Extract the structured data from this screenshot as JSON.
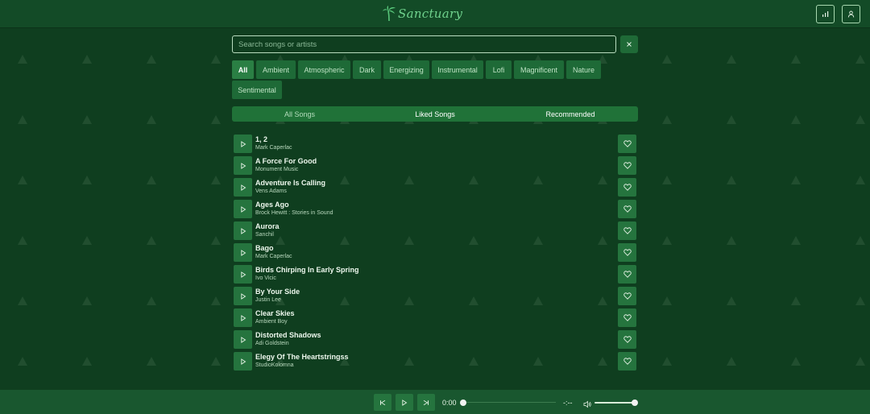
{
  "app": {
    "title": "Sanctuary"
  },
  "header": {
    "stats_icon": "bar-chart-icon",
    "user_icon": "user-icon"
  },
  "search": {
    "placeholder": "Search songs or artists",
    "value": ""
  },
  "genres": [
    {
      "label": "All",
      "active": true
    },
    {
      "label": "Ambient",
      "active": false
    },
    {
      "label": "Atmospheric",
      "active": false
    },
    {
      "label": "Dark",
      "active": false
    },
    {
      "label": "Energizing",
      "active": false
    },
    {
      "label": "Instrumental",
      "active": false
    },
    {
      "label": "Lofi",
      "active": false
    },
    {
      "label": "Magnificent",
      "active": false
    },
    {
      "label": "Nature",
      "active": false
    },
    {
      "label": "Sentimental",
      "active": false
    }
  ],
  "tabs": [
    {
      "label": "All Songs",
      "active": true
    },
    {
      "label": "Liked Songs",
      "active": false
    },
    {
      "label": "Recommended",
      "active": false
    }
  ],
  "songs": [
    {
      "title": "1, 2",
      "artist": "Mark Caperlac"
    },
    {
      "title": "A Force For Good",
      "artist": "Monument Music"
    },
    {
      "title": "Adventure Is Calling",
      "artist": "Vens Adams"
    },
    {
      "title": "Ages Ago",
      "artist": "Brock Hewitt : Stories in Sound"
    },
    {
      "title": "Aurora",
      "artist": "Sanchil"
    },
    {
      "title": "Bago",
      "artist": "Mark Caperlac"
    },
    {
      "title": "Birds Chirping In Early Spring",
      "artist": "Ivo Vicic"
    },
    {
      "title": "By Your Side",
      "artist": "Justin Lee"
    },
    {
      "title": "Clear Skies",
      "artist": "Ambient Boy"
    },
    {
      "title": "Distorted Shadows",
      "artist": "Adi Goldstein"
    },
    {
      "title": "Elegy Of The Heartstringss",
      "artist": "StudioKolomna"
    }
  ],
  "player": {
    "current_time": "0:00",
    "duration": "-:--",
    "progress": 0,
    "volume": 1.0
  },
  "colors": {
    "background": "#0f3e1f",
    "header": "#134b27",
    "button": "#25743e",
    "accent": "#6fd28d"
  }
}
